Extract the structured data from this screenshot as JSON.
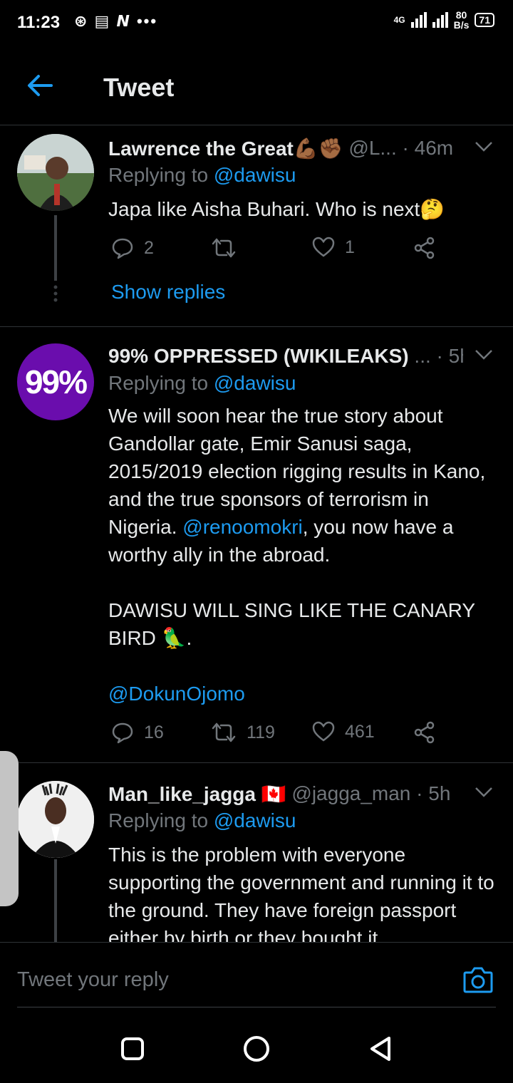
{
  "status_bar": {
    "time": "11:23",
    "notif_icons": "⊛ ▤ 𝙉 •••",
    "network": "4G",
    "speed_value": "80",
    "speed_unit": "B/s",
    "battery": "71"
  },
  "header": {
    "title": "Tweet"
  },
  "tweets": [
    {
      "name": "Lawrence the Great💪🏾✊🏾",
      "handle": "@L...",
      "time": "· 46m",
      "replying_prefix": "Replying to",
      "replying_to": "@dawisu",
      "text": "Japa like Aisha Buhari. Who is next🤔",
      "replies": "2",
      "retweets": "",
      "likes": "1",
      "show_replies": "Show replies"
    },
    {
      "name": "99% OPPRESSED (WIKILEAKS)",
      "handle": "...",
      "time": "· 5h",
      "avatar_text": "99%",
      "replying_prefix": "Replying to",
      "replying_to": "@dawisu",
      "text_part1": "We will soon hear the true story about Gandollar gate, Emir Sanusi saga, 2015/2019 election rigging results in Kano, and the true sponsors of terrorism in Nigeria. ",
      "text_mention": "@renoomokri",
      "text_part2": ", you now have a worthy ally in the abroad.\n\nDAWISU WILL SING LIKE THE CANARY BIRD 🦜.\n\n",
      "text_mention2": "@DokunOjomo",
      "replies": "16",
      "retweets": "119",
      "likes": "461"
    },
    {
      "name": "Man_like_jagga 🇨🇦",
      "handle": "@jagga_man",
      "time": "· 5h",
      "replying_prefix": "Replying to",
      "replying_to": "@dawisu",
      "text": "This is the problem with everyone supporting the government and running it to the ground. They have foreign passport either by birth or they bought it"
    }
  ],
  "reply_bar": {
    "placeholder": "Tweet your reply"
  },
  "colors": {
    "accent": "#1d9bf0",
    "avatar_99": "#6a0dad",
    "background": "#000000"
  }
}
